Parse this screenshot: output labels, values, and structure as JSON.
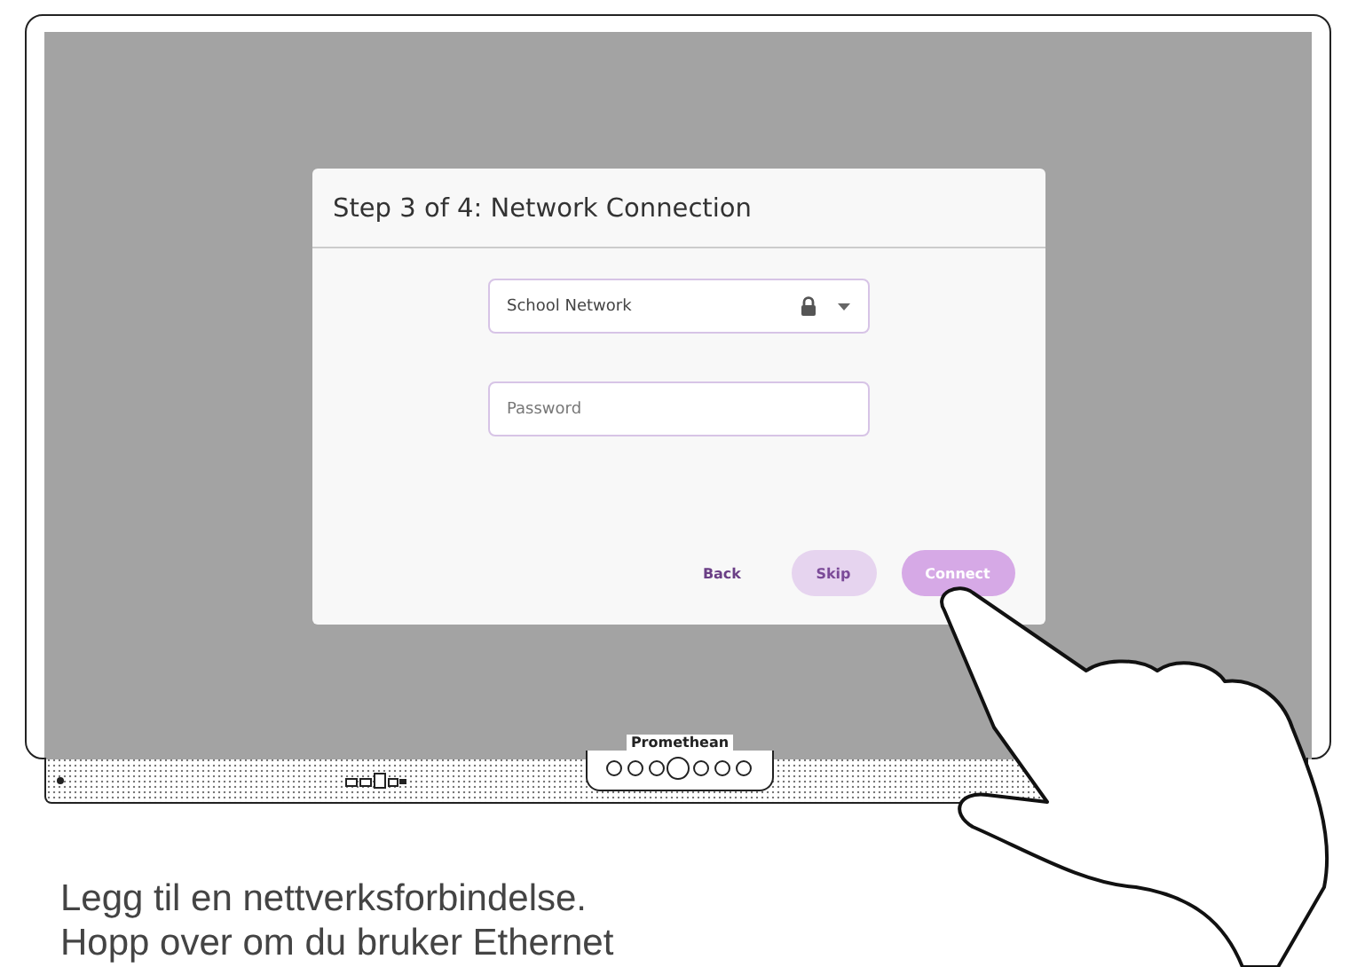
{
  "device": {
    "brand": "Promethean"
  },
  "dialog": {
    "title": "Step 3 of 4: Network Connection",
    "network_field": {
      "value": "School Network",
      "secured": true
    },
    "password_field": {
      "placeholder": "Password"
    },
    "buttons": [
      {
        "label": "Back",
        "kind": "text"
      },
      {
        "label": "Skip",
        "kind": "tonal"
      },
      {
        "label": "Connect",
        "kind": "primary"
      }
    ]
  },
  "caption": [
    "Legg til en nettverksforbindelse.",
    "Hopp over om du bruker Ethernet"
  ]
}
